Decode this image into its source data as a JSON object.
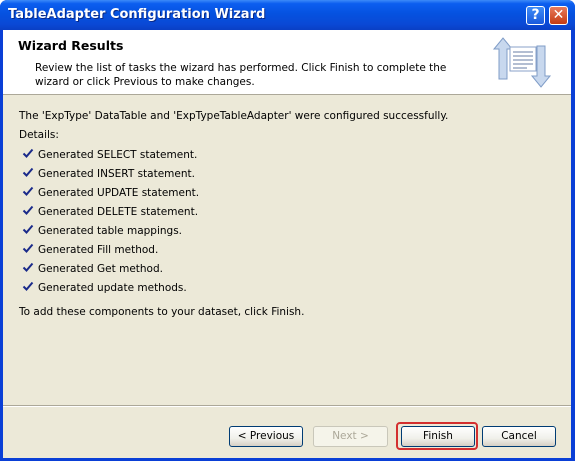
{
  "window": {
    "title": "TableAdapter Configuration Wizard",
    "help_label": "?",
    "close_label": "✕"
  },
  "header": {
    "title": "Wizard Results",
    "description": "Review the list of tasks the wizard has performed. Click Finish to complete the wizard or click Previous to make changes.",
    "icon": "wizard-data-icon"
  },
  "content": {
    "intro": "The 'ExpType' DataTable and 'ExpTypeTableAdapter' were configured successfully.",
    "details_label": "Details:",
    "tasks": [
      "Generated SELECT statement.",
      "Generated INSERT statement.",
      "Generated UPDATE statement.",
      "Generated DELETE statement.",
      "Generated table mappings.",
      "Generated Fill method.",
      "Generated Get method.",
      "Generated update methods."
    ],
    "footer_note": "To add these components to your dataset, click Finish."
  },
  "buttons": {
    "previous": "< Previous",
    "next": "Next >",
    "finish": "Finish",
    "cancel": "Cancel"
  },
  "colors": {
    "title_bar": "#0a49d6",
    "client_bg": "#ece9d8",
    "highlight": "#d32f2f",
    "check": "#1a2a8a"
  }
}
